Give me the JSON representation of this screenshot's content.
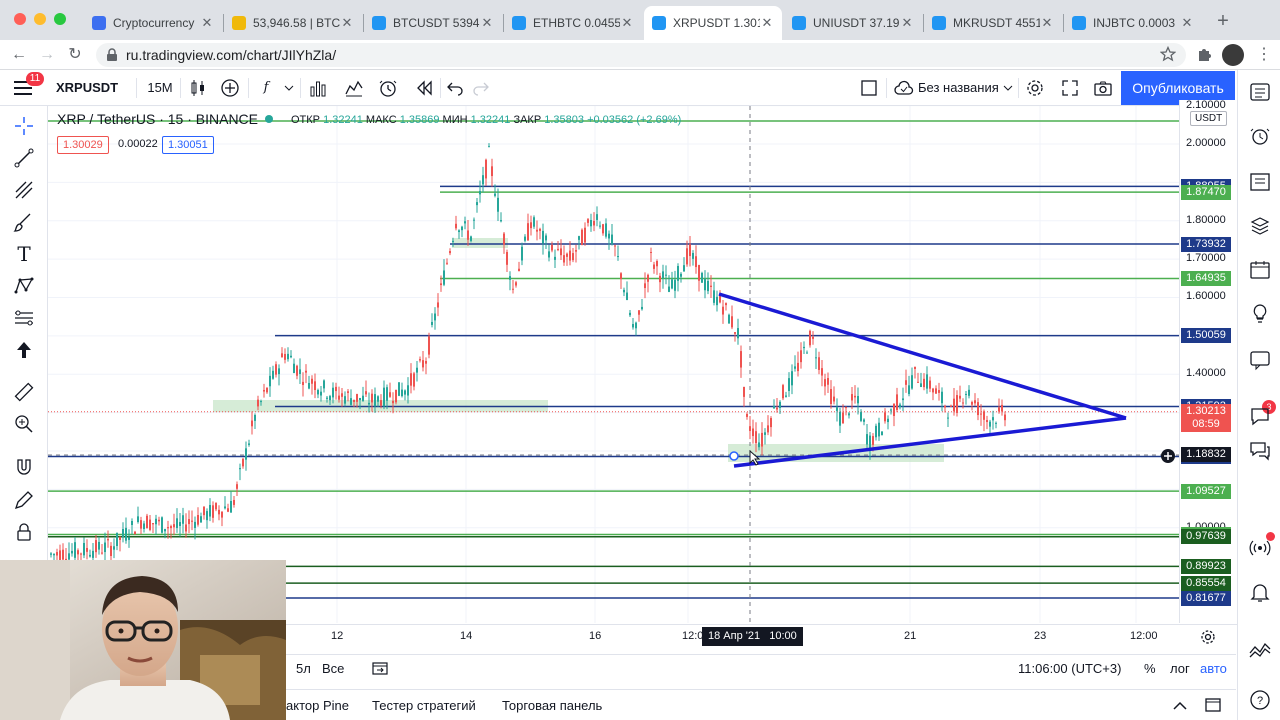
{
  "browser": {
    "tabs": [
      {
        "label": "Cryptocurrency",
        "icon": "tradingview-icon",
        "color": "#3d6ff0",
        "active": false
      },
      {
        "label": "53,946.58 | BTC",
        "icon": "binance-icon",
        "color": "#f0b90b",
        "active": false
      },
      {
        "label": "BTCUSDT 5394",
        "icon": "tradingview-cloud-icon",
        "color": "#2196f3",
        "active": false
      },
      {
        "label": "ETHBTC 0.0455",
        "icon": "tradingview-cloud-icon",
        "color": "#2196f3",
        "active": false
      },
      {
        "label": "XRPUSDT 1.301",
        "icon": "tradingview-cloud-icon",
        "color": "#2196f3",
        "active": true
      },
      {
        "label": "UNIUSDT 37.19",
        "icon": "tradingview-cloud-icon",
        "color": "#2196f3",
        "active": false
      },
      {
        "label": "MKRUSDT 4551",
        "icon": "tradingview-cloud-icon",
        "color": "#2196f3",
        "active": false
      },
      {
        "label": "INJBTC 0.0003",
        "icon": "tradingview-cloud-icon",
        "color": "#2196f3",
        "active": false
      }
    ],
    "url": "ru.tradingview.com/chart/JIlYhZla/"
  },
  "toolbar": {
    "symbol": "XRPUSDT",
    "interval": "15M",
    "layout_name": "Без названия",
    "publish_label": "Опубликовать",
    "menu_badge": "11"
  },
  "legend": {
    "title": "XRP / TetherUS · 15 · BINANCE",
    "open_label": "ОТКР",
    "open": "1.32241",
    "high_label": "МАКС",
    "high": "1.35869",
    "low_label": "МИН",
    "low": "1.32241",
    "close_label": "ЗАКР",
    "close": "1.35803",
    "change": "+0.03562 (+2.69%)",
    "bid": "1.30029",
    "spread": "0.00022",
    "ask": "1.30051"
  },
  "price_axis": {
    "currency": "USDT",
    "ticks": [
      "2.10000",
      "2.00000",
      "1.80000",
      "1.70000",
      "1.60000",
      "1.40000",
      "1.00000"
    ],
    "current_price": "1.30213",
    "countdown": "08:59",
    "crosshair_price": "1.18832"
  },
  "levels": [
    {
      "price": "2.06",
      "color": "#4caf50"
    },
    {
      "price": "1.88955",
      "color": "#1e3a8a"
    },
    {
      "price": "1.87470",
      "color": "#4caf50"
    },
    {
      "price": "1.73932",
      "color": "#1e3a8a"
    },
    {
      "price": "1.64935",
      "color": "#4caf50"
    },
    {
      "price": "1.50059",
      "color": "#1e3a8a"
    },
    {
      "price": "1.31592",
      "color": "#1e3a8a"
    },
    {
      "price": "1.18558",
      "color": "#1e3a8a"
    },
    {
      "price": "1.09527",
      "color": "#4caf50"
    },
    {
      "price": "0.98232",
      "color": "#4caf50"
    },
    {
      "price": "0.97639",
      "color": "#1b5e20"
    },
    {
      "price": "0.89923",
      "color": "#1b5e20"
    },
    {
      "price": "0.85554",
      "color": "#1b5e20"
    },
    {
      "price": "0.81677",
      "color": "#1e3a8a"
    }
  ],
  "time_axis": {
    "labels": [
      "12",
      "14",
      "16",
      "12:00",
      "21",
      "23",
      "12:00"
    ],
    "crosshair_label": "18 Апр '21   10:00"
  },
  "range_bar": {
    "range_5y": "5л",
    "range_all": "Все",
    "clock": "11:06:00 (UTC+3)",
    "percent": "%",
    "log": "лог",
    "auto": "авто"
  },
  "bottom_panel": {
    "tabs": [
      "актор Pine",
      "Тестер стратегий",
      "Торговая панель"
    ]
  },
  "right_bar": {
    "badge_alerts": "3"
  },
  "colors": {
    "accent": "#2962ff",
    "up_candle": "#26a69a",
    "down_candle": "#ef5350",
    "triangle": "#1a1ad4"
  }
}
